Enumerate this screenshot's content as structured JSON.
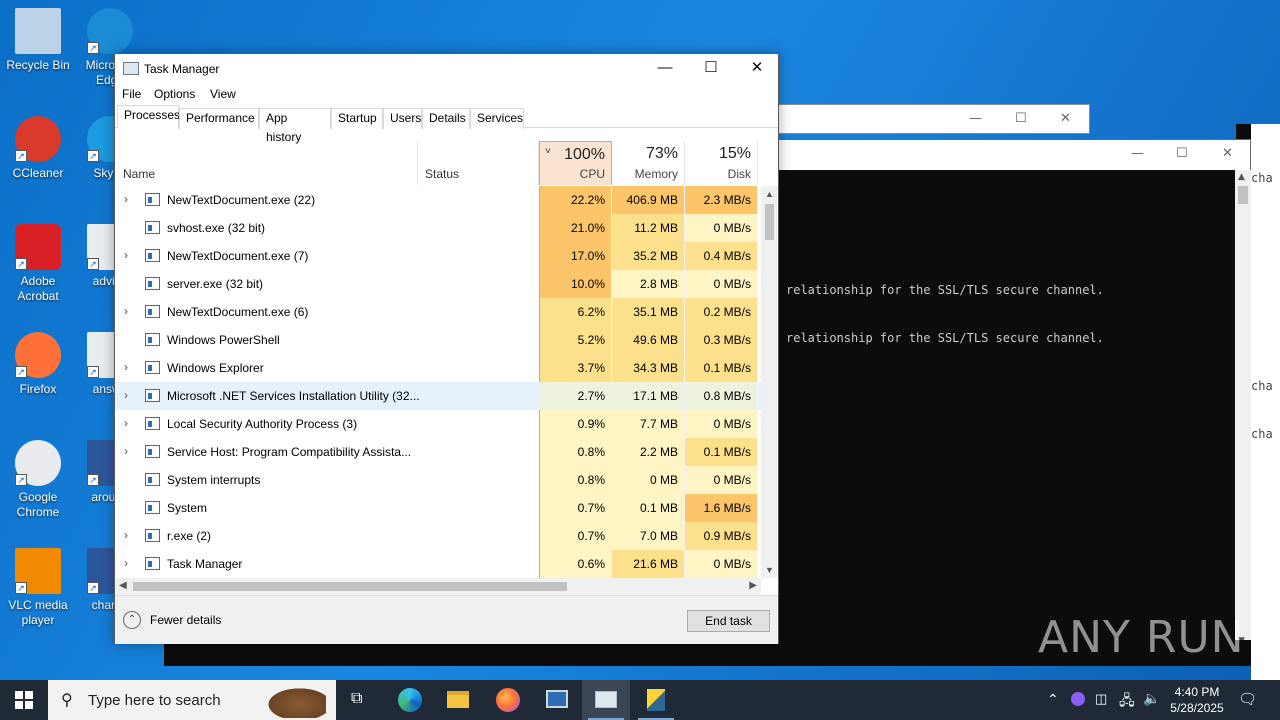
{
  "desktop": {
    "icons": [
      {
        "label": "Recycle Bin"
      },
      {
        "label": "Microsoft Edge"
      },
      {
        "label": "CCleaner"
      },
      {
        "label": "Skype"
      },
      {
        "label": "Adobe Acrobat"
      },
      {
        "label": "advice"
      },
      {
        "label": "Firefox"
      },
      {
        "label": "answe"
      },
      {
        "label": "Google Chrome"
      },
      {
        "label": "around"
      },
      {
        "label": "VLC media player"
      },
      {
        "label": "charge"
      }
    ]
  },
  "console": {
    "lines": [
      "relationship for the SSL/TLS secure channel.",
      "relationship for the SSL/TLS secure channel."
    ],
    "edge_text": [
      "cha",
      "cha",
      "cha"
    ]
  },
  "watermark": "ANY RUN",
  "task_manager": {
    "title": "Task Manager",
    "menu": [
      "File",
      "Options",
      "View"
    ],
    "tabs": [
      "Processes",
      "Performance",
      "App history",
      "Startup",
      "Users",
      "Details",
      "Services"
    ],
    "active_tab": "Processes",
    "columns": {
      "name": "Name",
      "status": "Status",
      "cpu": {
        "pct": "100%",
        "label": "CPU"
      },
      "memory": {
        "pct": "73%",
        "label": "Memory"
      },
      "disk": {
        "pct": "15%",
        "label": "Disk"
      }
    },
    "processes": [
      {
        "name": "NewTextDocument.exe (22)",
        "expandable": true,
        "cpu": "22.2%",
        "memory": "406.9 MB",
        "disk": "2.3 MB/s"
      },
      {
        "name": "svhost.exe (32 bit)",
        "expandable": false,
        "cpu": "21.0%",
        "memory": "11.2 MB",
        "disk": "0 MB/s"
      },
      {
        "name": "NewTextDocument.exe (7)",
        "expandable": true,
        "cpu": "17.0%",
        "memory": "35.2 MB",
        "disk": "0.4 MB/s"
      },
      {
        "name": "server.exe (32 bit)",
        "expandable": false,
        "cpu": "10.0%",
        "memory": "2.8 MB",
        "disk": "0 MB/s"
      },
      {
        "name": "NewTextDocument.exe (6)",
        "expandable": true,
        "cpu": "6.2%",
        "memory": "35.1 MB",
        "disk": "0.2 MB/s"
      },
      {
        "name": "Windows PowerShell",
        "expandable": false,
        "cpu": "5.2%",
        "memory": "49.6 MB",
        "disk": "0.3 MB/s"
      },
      {
        "name": "Windows Explorer",
        "expandable": true,
        "cpu": "3.7%",
        "memory": "34.3 MB",
        "disk": "0.1 MB/s"
      },
      {
        "name": "Microsoft .NET Services Installation Utility (32...",
        "expandable": true,
        "cpu": "2.7%",
        "memory": "17.1 MB",
        "disk": "0.8 MB/s",
        "selected": true
      },
      {
        "name": "Local Security Authority Process (3)",
        "expandable": true,
        "cpu": "0.9%",
        "memory": "7.7 MB",
        "disk": "0 MB/s"
      },
      {
        "name": "Service Host: Program Compatibility Assista...",
        "expandable": true,
        "cpu": "0.8%",
        "memory": "2.2 MB",
        "disk": "0.1 MB/s"
      },
      {
        "name": "System interrupts",
        "expandable": false,
        "cpu": "0.8%",
        "memory": "0 MB",
        "disk": "0 MB/s"
      },
      {
        "name": "System",
        "expandable": false,
        "cpu": "0.7%",
        "memory": "0.1 MB",
        "disk": "1.6 MB/s"
      },
      {
        "name": "r.exe (2)",
        "expandable": true,
        "cpu": "0.7%",
        "memory": "7.0 MB",
        "disk": "0.9 MB/s"
      },
      {
        "name": "Task Manager",
        "expandable": true,
        "cpu": "0.6%",
        "memory": "21.6 MB",
        "disk": "0 MB/s"
      }
    ],
    "fewer_details": "Fewer details",
    "end_task": "End task"
  },
  "taskbar": {
    "search_placeholder": "Type here to search",
    "time": "4:40 PM",
    "date": "5/28/2025"
  },
  "colors": {
    "cpu_high": "#fcc56a",
    "cpu_med": "#fde08c",
    "cpu_low": "#fff4c4",
    "selected_row": "#e5f1fb",
    "accent": "#0a74d2"
  }
}
